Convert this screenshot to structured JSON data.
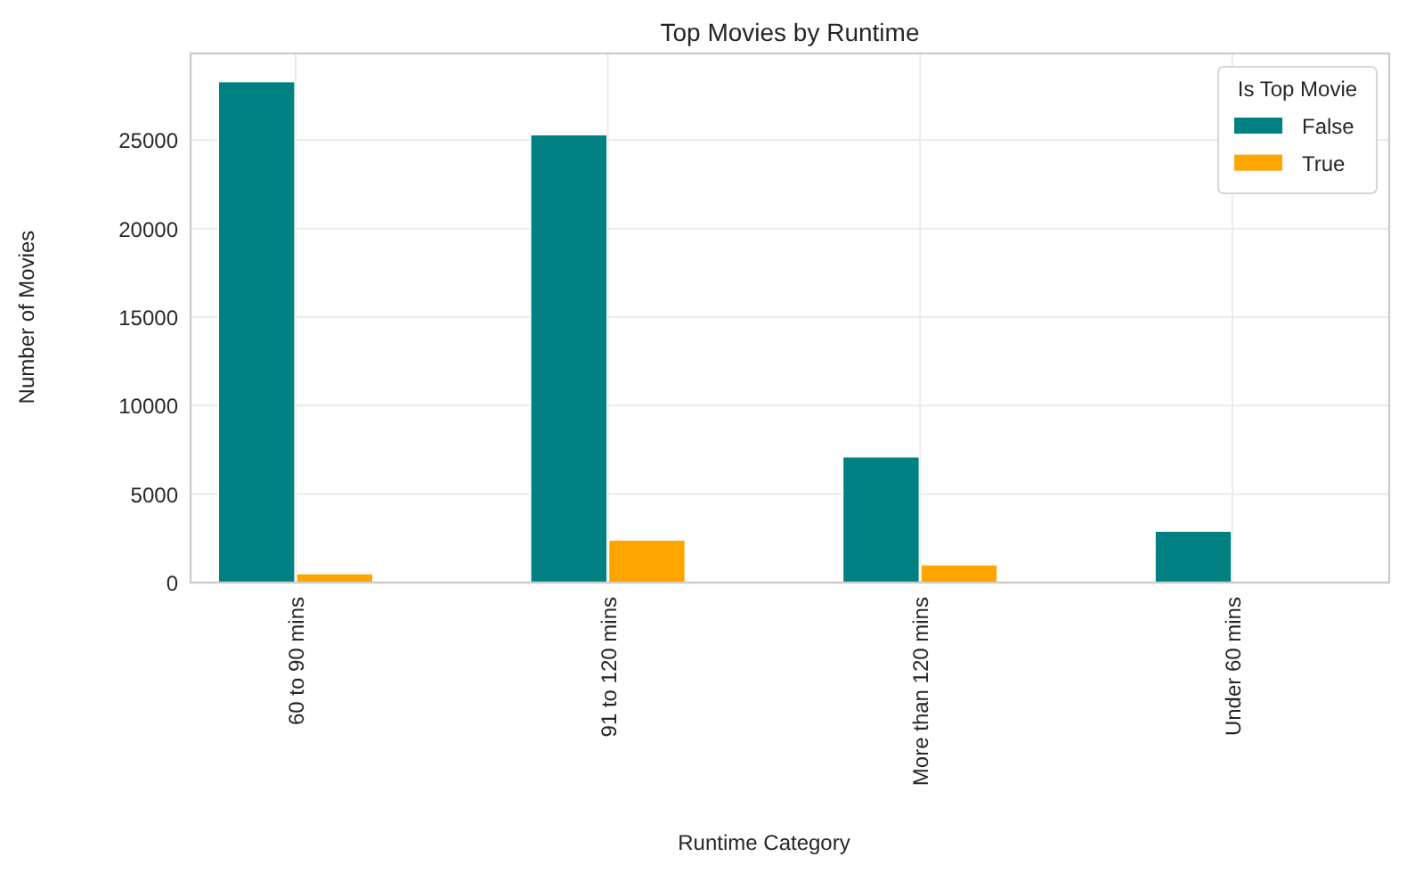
{
  "chart_data": {
    "type": "bar",
    "title": "Top Movies by Runtime",
    "xlabel": "Runtime Category",
    "ylabel": "Number of Movies",
    "categories": [
      "60 to 90 mins",
      "91 to 120 mins",
      "More than 120 mins",
      "Under 60 mins"
    ],
    "series": [
      {
        "name": "False",
        "color": "#008080",
        "values": [
          28300,
          25300,
          7100,
          2900
        ]
      },
      {
        "name": "True",
        "color": "#ffa500",
        "values": [
          500,
          2400,
          1000,
          0
        ]
      }
    ],
    "ylim": [
      0,
      29900
    ],
    "yticks": [
      0,
      5000,
      10000,
      15000,
      20000,
      25000
    ],
    "grid": true,
    "legend": {
      "title": "Is Top Movie"
    }
  }
}
